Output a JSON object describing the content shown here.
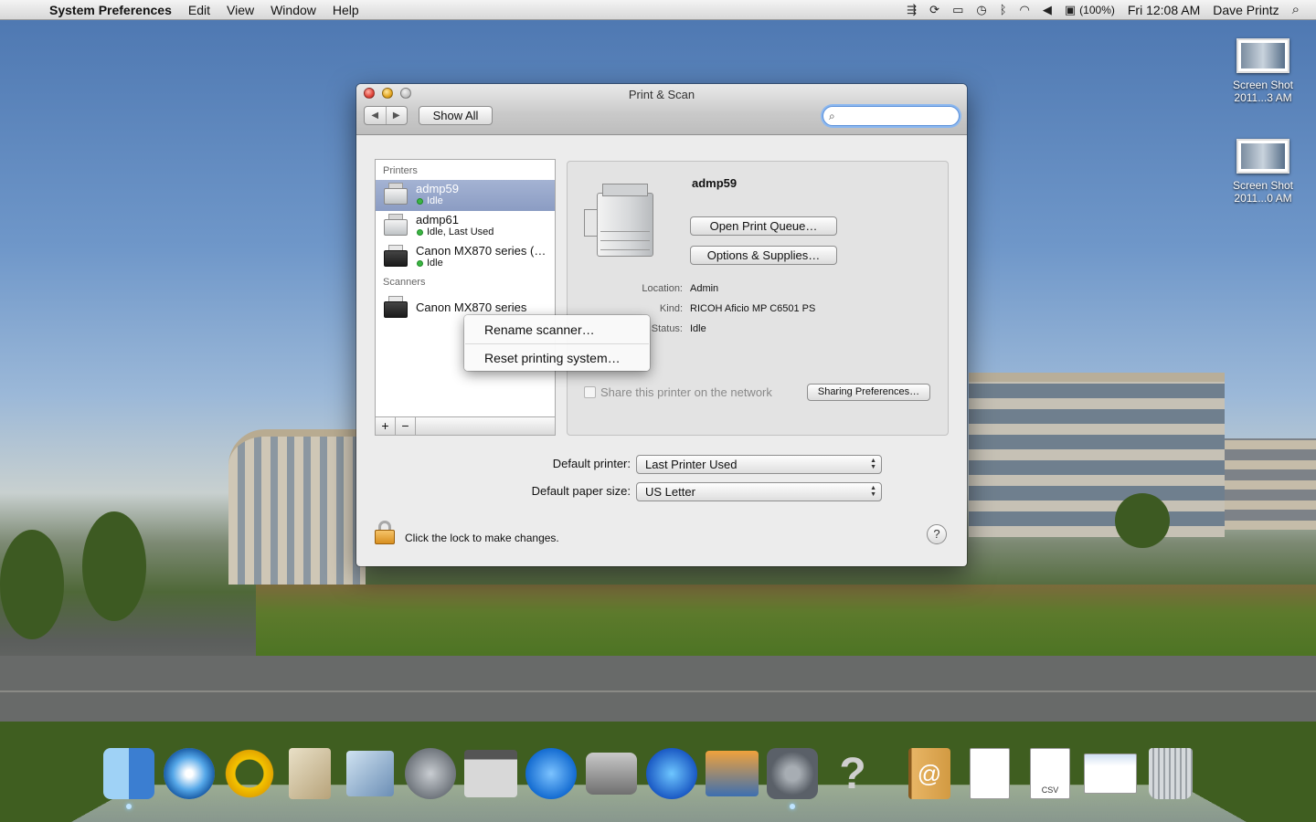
{
  "menubar": {
    "apple": "",
    "app_name": "System Preferences",
    "menus": [
      "Edit",
      "View",
      "Window",
      "Help"
    ],
    "battery": "(100%)",
    "clock": "Fri 12:08 AM",
    "user": "Dave Printz",
    "status_icons": [
      "time-machine-icon",
      "sync-icon",
      "battery-icon",
      "clock-icon",
      "bluetooth-icon",
      "wifi-icon",
      "volume-icon"
    ]
  },
  "desktop": {
    "icons": [
      {
        "label1": "Screen Shot",
        "label2": "2011...3 AM"
      },
      {
        "label1": "Screen Shot",
        "label2": "2011...0 AM"
      }
    ]
  },
  "window": {
    "title": "Print & Scan",
    "nav_back": "◀",
    "nav_forward": "▶",
    "show_all": "Show All",
    "search_value": "",
    "list": {
      "printers_header": "Printers",
      "printers": [
        {
          "name": "admp59",
          "status": "Idle",
          "selected": true
        },
        {
          "name": "admp61",
          "status": "Idle, Last Used",
          "selected": false
        },
        {
          "name": "Canon MX870 series (…",
          "status": "Idle",
          "selected": false
        }
      ],
      "scanners_header": "Scanners",
      "scanners": [
        {
          "name": "Canon MX870 series"
        }
      ],
      "add_label": "+",
      "remove_label": "−"
    },
    "context_menu": {
      "items": [
        "Rename scanner…",
        "Reset printing system…"
      ]
    },
    "detail": {
      "name": "admp59",
      "open_queue": "Open Print Queue…",
      "options_supplies": "Options & Supplies…",
      "location_label": "Location:",
      "location_value": "Admin",
      "kind_label": "Kind:",
      "kind_value": "RICOH Aficio MP C6501 PS",
      "status_label": "Status:",
      "status_value": "Idle",
      "share_label": "Share this printer on the network",
      "sharing_prefs": "Sharing Preferences…"
    },
    "default_printer_label": "Default printer:",
    "default_printer_value": "Last Printer Used",
    "default_paper_label": "Default paper size:",
    "default_paper_value": "US Letter",
    "lock_text": "Click the lock to make changes.",
    "help": "?"
  },
  "dock": {
    "contacts_glyph": "@",
    "doc_csv_label": "CSV",
    "question_glyph": "?"
  }
}
